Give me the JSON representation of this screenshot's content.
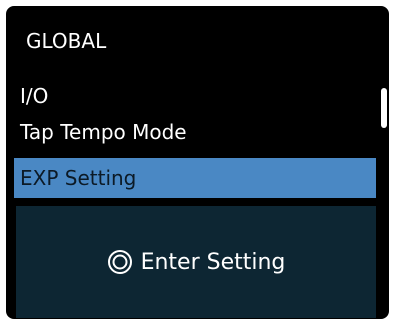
{
  "screen": {
    "title": "GLOBAL"
  },
  "menu": {
    "items": [
      {
        "label": "I/O"
      },
      {
        "label": "Tap Tempo Mode"
      },
      {
        "label": "EXP Setting",
        "selected": true
      }
    ]
  },
  "detail": {
    "action_label": "Enter Setting",
    "icon": "knob-press-icon"
  },
  "colors": {
    "background": "#000000",
    "selection": "#4a88c4",
    "panel": "#0d2633",
    "text": "#ffffff"
  }
}
